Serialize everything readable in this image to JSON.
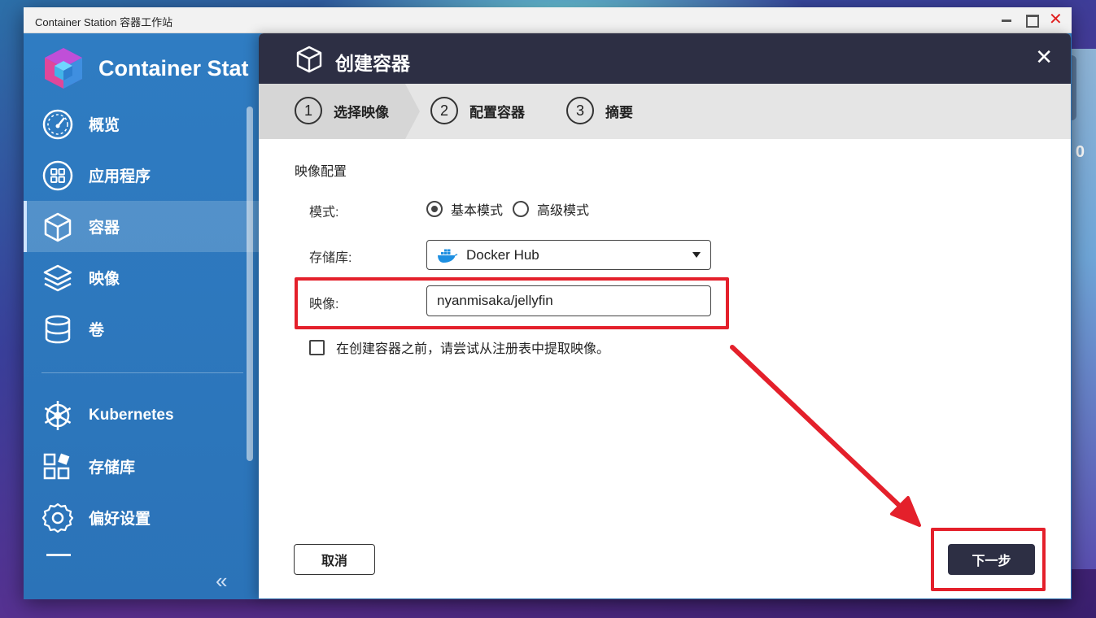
{
  "window": {
    "title": "Container Station 容器工作站",
    "controls": {
      "minimize": "minimize-icon",
      "maximize": "maximize-icon",
      "close": "✕"
    }
  },
  "sidebar": {
    "app_name": "Container Stat",
    "items": [
      {
        "label": "概览",
        "icon": "dashboard-gauge-icon"
      },
      {
        "label": "应用程序",
        "icon": "apps-grid-icon"
      },
      {
        "label": "容器",
        "icon": "cube-icon",
        "active": true
      },
      {
        "label": "映像",
        "icon": "layers-icon"
      },
      {
        "label": "卷",
        "icon": "database-icon"
      },
      {
        "label": "Kubernetes",
        "icon": "kubernetes-helm-icon"
      },
      {
        "label": "存储库",
        "icon": "repository-blocks-icon"
      },
      {
        "label": "偏好设置",
        "icon": "gear-icon"
      }
    ],
    "collapse_glyph": "«"
  },
  "dialog": {
    "title": "创建容器",
    "close_glyph": "✕",
    "steps": [
      {
        "num": "1",
        "label": "选择映像",
        "active": true
      },
      {
        "num": "2",
        "label": "配置容器"
      },
      {
        "num": "3",
        "label": "摘要"
      }
    ],
    "section_title": "映像配置",
    "mode": {
      "label": "模式:",
      "options": [
        {
          "label": "基本模式",
          "selected": true
        },
        {
          "label": "高级模式",
          "selected": false
        }
      ]
    },
    "registry": {
      "label": "存储库:",
      "value": "Docker Hub"
    },
    "image": {
      "label": "映像:",
      "value": "nyanmisaka/jellyfin"
    },
    "pull_checkbox": {
      "label": "在创建容器之前，请尝试从注册表中提取映像。",
      "checked": false
    },
    "cancel_label": "取消",
    "next_label": "下一步"
  },
  "background": {
    "right_edge_text": "0"
  },
  "colors": {
    "sidebar": "#2f7bc1",
    "dialog_header": "#2d2f44",
    "highlight": "#e4202b"
  }
}
